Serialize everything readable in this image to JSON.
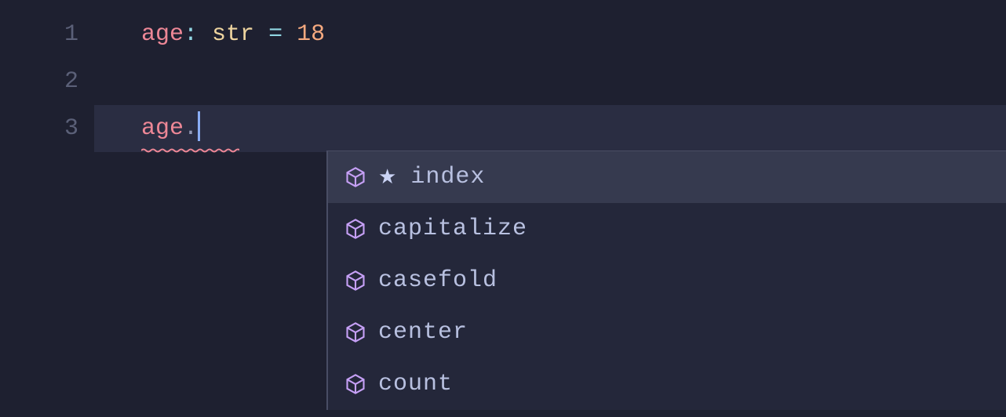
{
  "editor": {
    "lines": [
      {
        "number": "1",
        "tokens": [
          "age",
          ":",
          " ",
          "str",
          " ",
          "=",
          " ",
          "18"
        ]
      },
      {
        "number": "2",
        "tokens": []
      },
      {
        "number": "3",
        "tokens": [
          "age",
          "."
        ]
      }
    ],
    "line1": {
      "var": "age",
      "colon": ":",
      "type": "str",
      "equals": "=",
      "value": "18"
    },
    "line3": {
      "var": "age",
      "dot": "."
    }
  },
  "autocomplete": {
    "items": [
      {
        "label": "index",
        "starred": true,
        "icon": "method-icon",
        "selected": true
      },
      {
        "label": "capitalize",
        "starred": false,
        "icon": "method-icon",
        "selected": false
      },
      {
        "label": "casefold",
        "starred": false,
        "icon": "method-icon",
        "selected": false
      },
      {
        "label": "center",
        "starred": false,
        "icon": "method-icon",
        "selected": false
      },
      {
        "label": "count",
        "starred": false,
        "icon": "method-icon",
        "selected": false
      }
    ],
    "star_symbol": "★"
  },
  "colors": {
    "background": "#1e2030",
    "active_line": "#2a2d42",
    "popup_bg": "#24273a",
    "popup_selected": "#363a4f",
    "variable": "#ed8796",
    "type": "#eed49f",
    "number": "#f5a97f",
    "operator": "#91d7e3",
    "cursor": "#8aadf4",
    "icon_purple": "#c6a0f6",
    "squiggle": "#ed8796"
  }
}
